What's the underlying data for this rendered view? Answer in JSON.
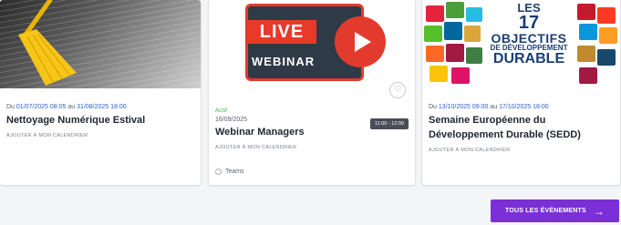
{
  "events": [
    {
      "date_prefix": "Du",
      "date_start": "01/07/2025 08:05",
      "date_sep": "au",
      "date_end": "31/08/2025 18:00",
      "title": "Nettoyage Numérique Estival",
      "add_calendar": "Ajouter à mon calendrier"
    },
    {
      "status": "Actif",
      "date": "16/09/2025",
      "time": "11:00 - 12:00",
      "title": "Webinar Managers",
      "add_calendar": "Ajouter à mon calendrier",
      "location": "Teams",
      "thumb_live": "LIVE",
      "thumb_webinar": "WEBINAR"
    },
    {
      "date_prefix": "Du",
      "date_start": "13/10/2025 09:00",
      "date_sep": "au",
      "date_end": "17/10/2025 18:00",
      "title_line1": "Semaine Européenne du",
      "title_line2": "Développement Durable (SEDD)",
      "add_calendar": "Ajouter à mon calendrier",
      "thumb_les": "LES",
      "thumb_17": "17",
      "thumb_objectifs": "OBJECTIFS",
      "thumb_dev": "DE DÉVELOPPEMENT",
      "thumb_durable": "DURABLE"
    }
  ],
  "all_events_button": "TOUS LES ÉVÉNEMENTS",
  "colors": {
    "accent": "#7b2fd6",
    "live_red": "#e23b2e",
    "active_green": "#34a853",
    "date_blue": "#2b5fd0"
  },
  "icons": [
    "heart-icon",
    "arrow-right-icon",
    "location-icon",
    "play-icon",
    "broom-icon"
  ]
}
